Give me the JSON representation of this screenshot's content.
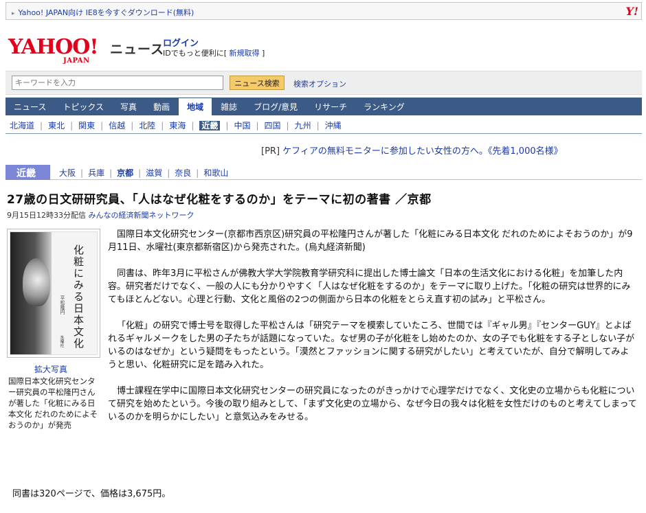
{
  "topbar": {
    "promo": "Yahoo! JAPAN向け IE8を今すぐダウンロード(無料)",
    "logo": "Y!"
  },
  "header": {
    "logo_main": "YAHOO!",
    "logo_sub": "JAPAN",
    "section_title": "ニュース",
    "login": "ログイン",
    "login_sub_prefix": "IDでもっと便利に[",
    "register": "新規取得",
    "login_sub_suffix": "]"
  },
  "search": {
    "placeholder": "キーワードを入力",
    "button": "ニュース検索",
    "options": "検索オプション"
  },
  "mainnav": [
    {
      "label": "ニュース"
    },
    {
      "label": "トピックス"
    },
    {
      "label": "写真"
    },
    {
      "label": "動画"
    },
    {
      "label": "地域",
      "active": true
    },
    {
      "label": "雑誌"
    },
    {
      "label": "ブログ/意見"
    },
    {
      "label": "リサーチ"
    },
    {
      "label": "ランキング"
    }
  ],
  "subnav": [
    "北海道",
    "東北",
    "関東",
    "信越",
    "北陸",
    "東海",
    "近畿",
    "中国",
    "四国",
    "九州",
    "沖縄"
  ],
  "subnav_active": "近畿",
  "pr": {
    "tag": "[PR]",
    "text": "ケフィアの無料モニターに参加したい女性の方へ。《先着1,000名様》"
  },
  "region": {
    "label": "近畿",
    "prefectures": [
      "大阪",
      "兵庫",
      "京都",
      "滋賀",
      "奈良",
      "和歌山"
    ],
    "active": "京都"
  },
  "article": {
    "headline": "27歳の日文研研究員、「人はなぜ化粧をするのか」をテーマに初の著書 ／京都",
    "date": "9月15日12時33分配信",
    "source": "みんなの経済新聞ネットワーク",
    "photo_enlarge": "拡大写真",
    "photo_caption": "国際日本文化研究センター研究員の平松隆円さんが著した「化粧にみる日本文化 だれのためによそおうのか」が発売",
    "book": {
      "title": "化粧にみる日本文化",
      "author": "平松隆円",
      "publisher": "水曜社"
    },
    "paragraphs": [
      "国際日本文化研究センター(京都市西京区)研究員の平松隆円さんが著した「化粧にみる日本文化 だれのためによそおうのか」が9月11日、水曜社(東京都新宿区)から発売された。(烏丸経済新聞)",
      "同書は、昨年3月に平松さんが佛教大学大学院教育学研究科に提出した博士論文「日本の生活文化における化粧」を加筆した内容。研究者だけでなく、一般の人にも分かりやすく「人はなぜ化粧をするのか」をテーマに取り上げた。「化粧の研究は世界的にみてもほとんどない。心理と行動、文化と風俗の2つの側面から日本の化粧をとらえ直す初の試み」と平松さん。",
      "「化粧」の研究で博士号を取得した平松さんは「研究テーマを模索していたころ、世間では『ギャル男』『センターGUY』とよばれるギャルメークをした男の子たちが話題になっていた。なぜ男の子が化粧をし始めたのか、女の子でも化粧をする子としない子がいるのはなぜか」という疑問をもったという。「漠然とファッションに関する研究がしたい」と考えていたが、自分で解明してみようと思い、化粧研究に足を踏み入れた。",
      "博士課程在学中に国際日本文化研究センターの研究員になったのがきっかけで心理学だけでなく、文化史の立場からも化粧について研究を始めたという。今後の取り組みとして、「まず文化史の立場から、なぜ今日の我々は化粧を女性だけのものと考えてしまっているのかを明らかにしたい」と意気込みをみせる。"
    ],
    "closing": "同書は320ページで、価格は3,675円。"
  }
}
